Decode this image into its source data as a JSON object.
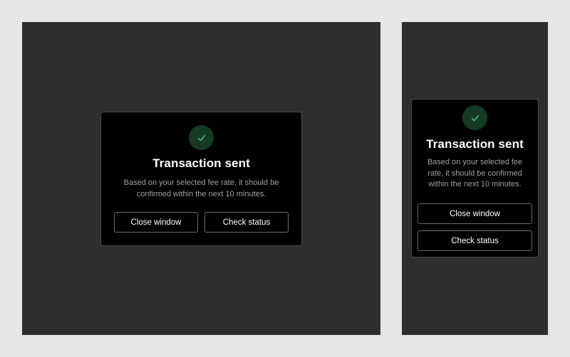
{
  "colors": {
    "page_background": "#e6e6e6",
    "frame_background": "#2e2e2e",
    "modal_background": "#000000",
    "modal_border": "#4a4a4a",
    "success_badge": "#163a26",
    "success_check": "#4cc37a",
    "body_text": "#a0a0a0",
    "button_border": "#6a6a6a"
  },
  "desktop": {
    "modal": {
      "icon": "checkmark-icon",
      "title": "Transaction sent",
      "body_line_1": "Based on your selected fee rate, it should be",
      "body_line_2": "confirmed within the next 10 minutes.",
      "close_label": "Close window",
      "check_label": "Check status"
    }
  },
  "mobile": {
    "modal": {
      "icon": "checkmark-icon",
      "title": "Transaction sent",
      "body_line_1": "Based on your selected fee",
      "body_line_2": "rate, it should be confirmed",
      "body_line_3": "within the next 10 minutes.",
      "close_label": "Close window",
      "check_label": "Check status"
    }
  }
}
